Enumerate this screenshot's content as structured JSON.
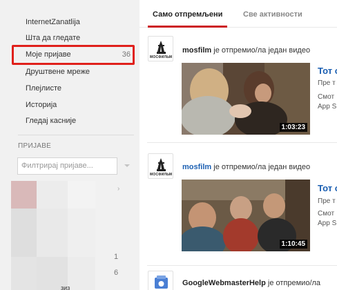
{
  "sidebar": {
    "items": [
      {
        "label": "InternetZanatlija",
        "count": ""
      },
      {
        "label": "Шта да гледате",
        "count": ""
      },
      {
        "label": "Моје пријаве",
        "count": "36"
      },
      {
        "label": "Друштвене мреже",
        "count": ""
      },
      {
        "label": "Плејлисте",
        "count": ""
      },
      {
        "label": "Историја",
        "count": ""
      },
      {
        "label": "Гледај касније",
        "count": ""
      }
    ],
    "section_title": "ПРИЈАВЕ",
    "filter_placeholder": "Филтрирај пријаве...",
    "sub_counts": [
      "1",
      "6"
    ],
    "cut_text": "зиз"
  },
  "tabs": {
    "active": "Само отпремљени",
    "inactive": "Све активности"
  },
  "feed": [
    {
      "channel": "mosfilm",
      "avatar_text": "МОСФИЛЬМ",
      "action": "је отпремио/ла један видео",
      "duration": "1:03:23",
      "title": "Тот с",
      "meta1": "Пре т",
      "meta2": "Смот",
      "meta3": "App S"
    },
    {
      "channel": "mosfilm",
      "avatar_text": "МОСФИЛЬМ",
      "action": "је отпремио/ла један видео",
      "duration": "1:10:45",
      "title": "Тот с",
      "meta1": "Пре т",
      "meta2": "Смот",
      "meta3": "App S"
    },
    {
      "channel": "GoogleWebmasterHelp",
      "action": "је отпремио/ла"
    }
  ],
  "colors": {
    "accent_red": "#cc181e",
    "highlight_red": "#e0201b",
    "link_blue": "#1b5fb2"
  }
}
